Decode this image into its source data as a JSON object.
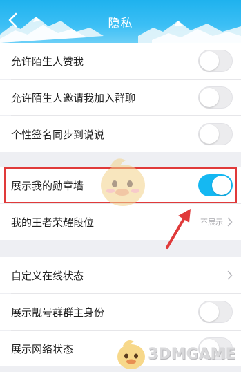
{
  "header": {
    "title": "隐私",
    "background_color": "#1fb2ee",
    "back_icon": "chevron-left-icon"
  },
  "settings": [
    {
      "label": "允许陌生人赞我",
      "control": "toggle",
      "on": false
    },
    {
      "label": "允许陌生人邀请我加入群聊",
      "control": "toggle",
      "on": false
    },
    {
      "label": "个性签名同步到说说",
      "control": "toggle",
      "on": false
    },
    {
      "label": "展示我的勋章墙",
      "control": "toggle",
      "on": true
    },
    {
      "label": "我的王者荣耀段位",
      "control": "link",
      "value": "不展示"
    },
    {
      "label": "自定义在线状态",
      "control": "link",
      "value": ""
    },
    {
      "label": "展示靓号群群主身份",
      "control": "toggle",
      "on": false
    },
    {
      "label": "展示网络状态",
      "control": "toggle",
      "on": false
    }
  ],
  "annotation": {
    "highlight_color": "#e03a3a",
    "arrow_color": "#e03a3a"
  },
  "watermark": {
    "text": "3DMGAME"
  },
  "colors": {
    "toggle_on": "#15b8f2",
    "toggle_off": "#ececee",
    "page_bg": "#eeeff3"
  }
}
